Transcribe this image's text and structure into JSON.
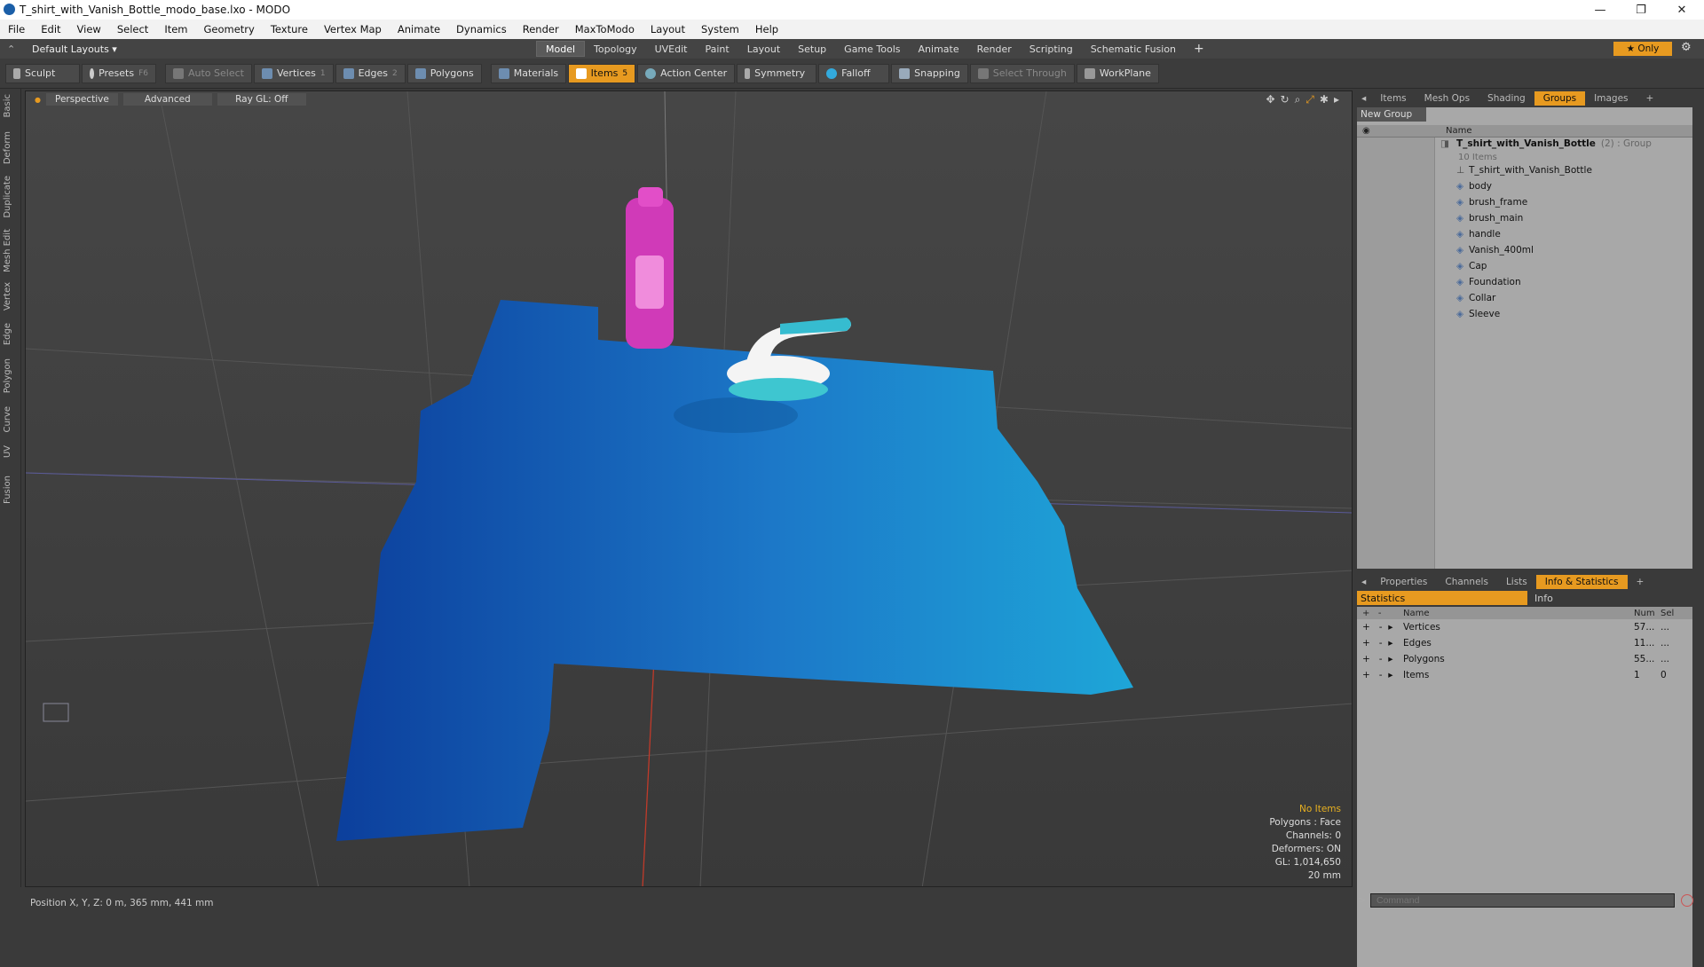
{
  "window": {
    "title": "T_shirt_with_Vanish_Bottle_modo_base.lxo - MODO",
    "min": "—",
    "max": "❐",
    "close": "✕"
  },
  "menu": [
    "File",
    "Edit",
    "View",
    "Select",
    "Item",
    "Geometry",
    "Texture",
    "Vertex Map",
    "Animate",
    "Dynamics",
    "Render",
    "MaxToModo",
    "Layout",
    "System",
    "Help"
  ],
  "layouts": {
    "label": "Default Layouts ▾",
    "tabs": [
      "Model",
      "Topology",
      "UVEdit",
      "Paint",
      "Layout",
      "Setup",
      "Game Tools",
      "Animate",
      "Render",
      "Scripting",
      "Schematic Fusion"
    ],
    "add": "+",
    "only": "★  Only",
    "gear": "⚙"
  },
  "toolbar": {
    "sculpt": "Sculpt",
    "presets": "Presets",
    "presets_key": "F6",
    "auto_select": "Auto Select",
    "vertices": "Vertices",
    "vertices_n": "1",
    "edges": "Edges",
    "edges_n": "2",
    "polygons": "Polygons",
    "materials": "Materials",
    "items": "Items",
    "items_n": "5",
    "action_center": "Action Center",
    "symmetry": "Symmetry",
    "falloff": "Falloff",
    "snapping": "Snapping",
    "select_through": "Select Through",
    "workplane": "WorkPlane"
  },
  "left_tabs": [
    "Basic",
    "Deform",
    "Duplicate",
    "Mesh Edit",
    "Vertex",
    "Edge",
    "Polygon",
    "Curve",
    "UV",
    "Fusion"
  ],
  "viewport": {
    "perspective": "Perspective",
    "advanced": "Advanced",
    "raygl": "Ray GL: Off",
    "stats": {
      "no_items": "No Items",
      "polygons": "Polygons : Face",
      "channels": "Channels: 0",
      "deformers": "Deformers: ON",
      "gl": "GL: 1,014,650",
      "scale": "20 mm"
    }
  },
  "status": {
    "position": "Position X, Y, Z:  0 m, 365 mm, 441 mm"
  },
  "outliner": {
    "tabs": [
      "Items",
      "Mesh Ops",
      "Shading",
      "Groups",
      "Images"
    ],
    "active": "Groups",
    "new_group": "New Group",
    "col_name": "Name",
    "group_name": "T_shirt_with_Vanish_Bottle",
    "group_suffix": "(2) : Group",
    "group_count": "10 Items",
    "items": [
      "T_shirt_with_Vanish_Bottle",
      "body",
      "brush_frame",
      "brush_main",
      "handle",
      "Vanish_400ml",
      "Cap",
      "Foundation",
      "Collar",
      "Sleeve"
    ]
  },
  "info": {
    "tabs": [
      "Properties",
      "Channels",
      "Lists",
      "Info & Statistics"
    ],
    "active": "Info & Statistics",
    "sub_tabs": [
      "Statistics",
      "Info"
    ],
    "cols": [
      "Name",
      "Num",
      "Sel"
    ],
    "rows": [
      {
        "name": "Vertices",
        "num": "57...",
        "sel": "..."
      },
      {
        "name": "Edges",
        "num": "11...",
        "sel": "..."
      },
      {
        "name": "Polygons",
        "num": "55...",
        "sel": "..."
      },
      {
        "name": "Items",
        "num": "1",
        "sel": "0"
      }
    ]
  },
  "command": {
    "placeholder": "Command"
  }
}
